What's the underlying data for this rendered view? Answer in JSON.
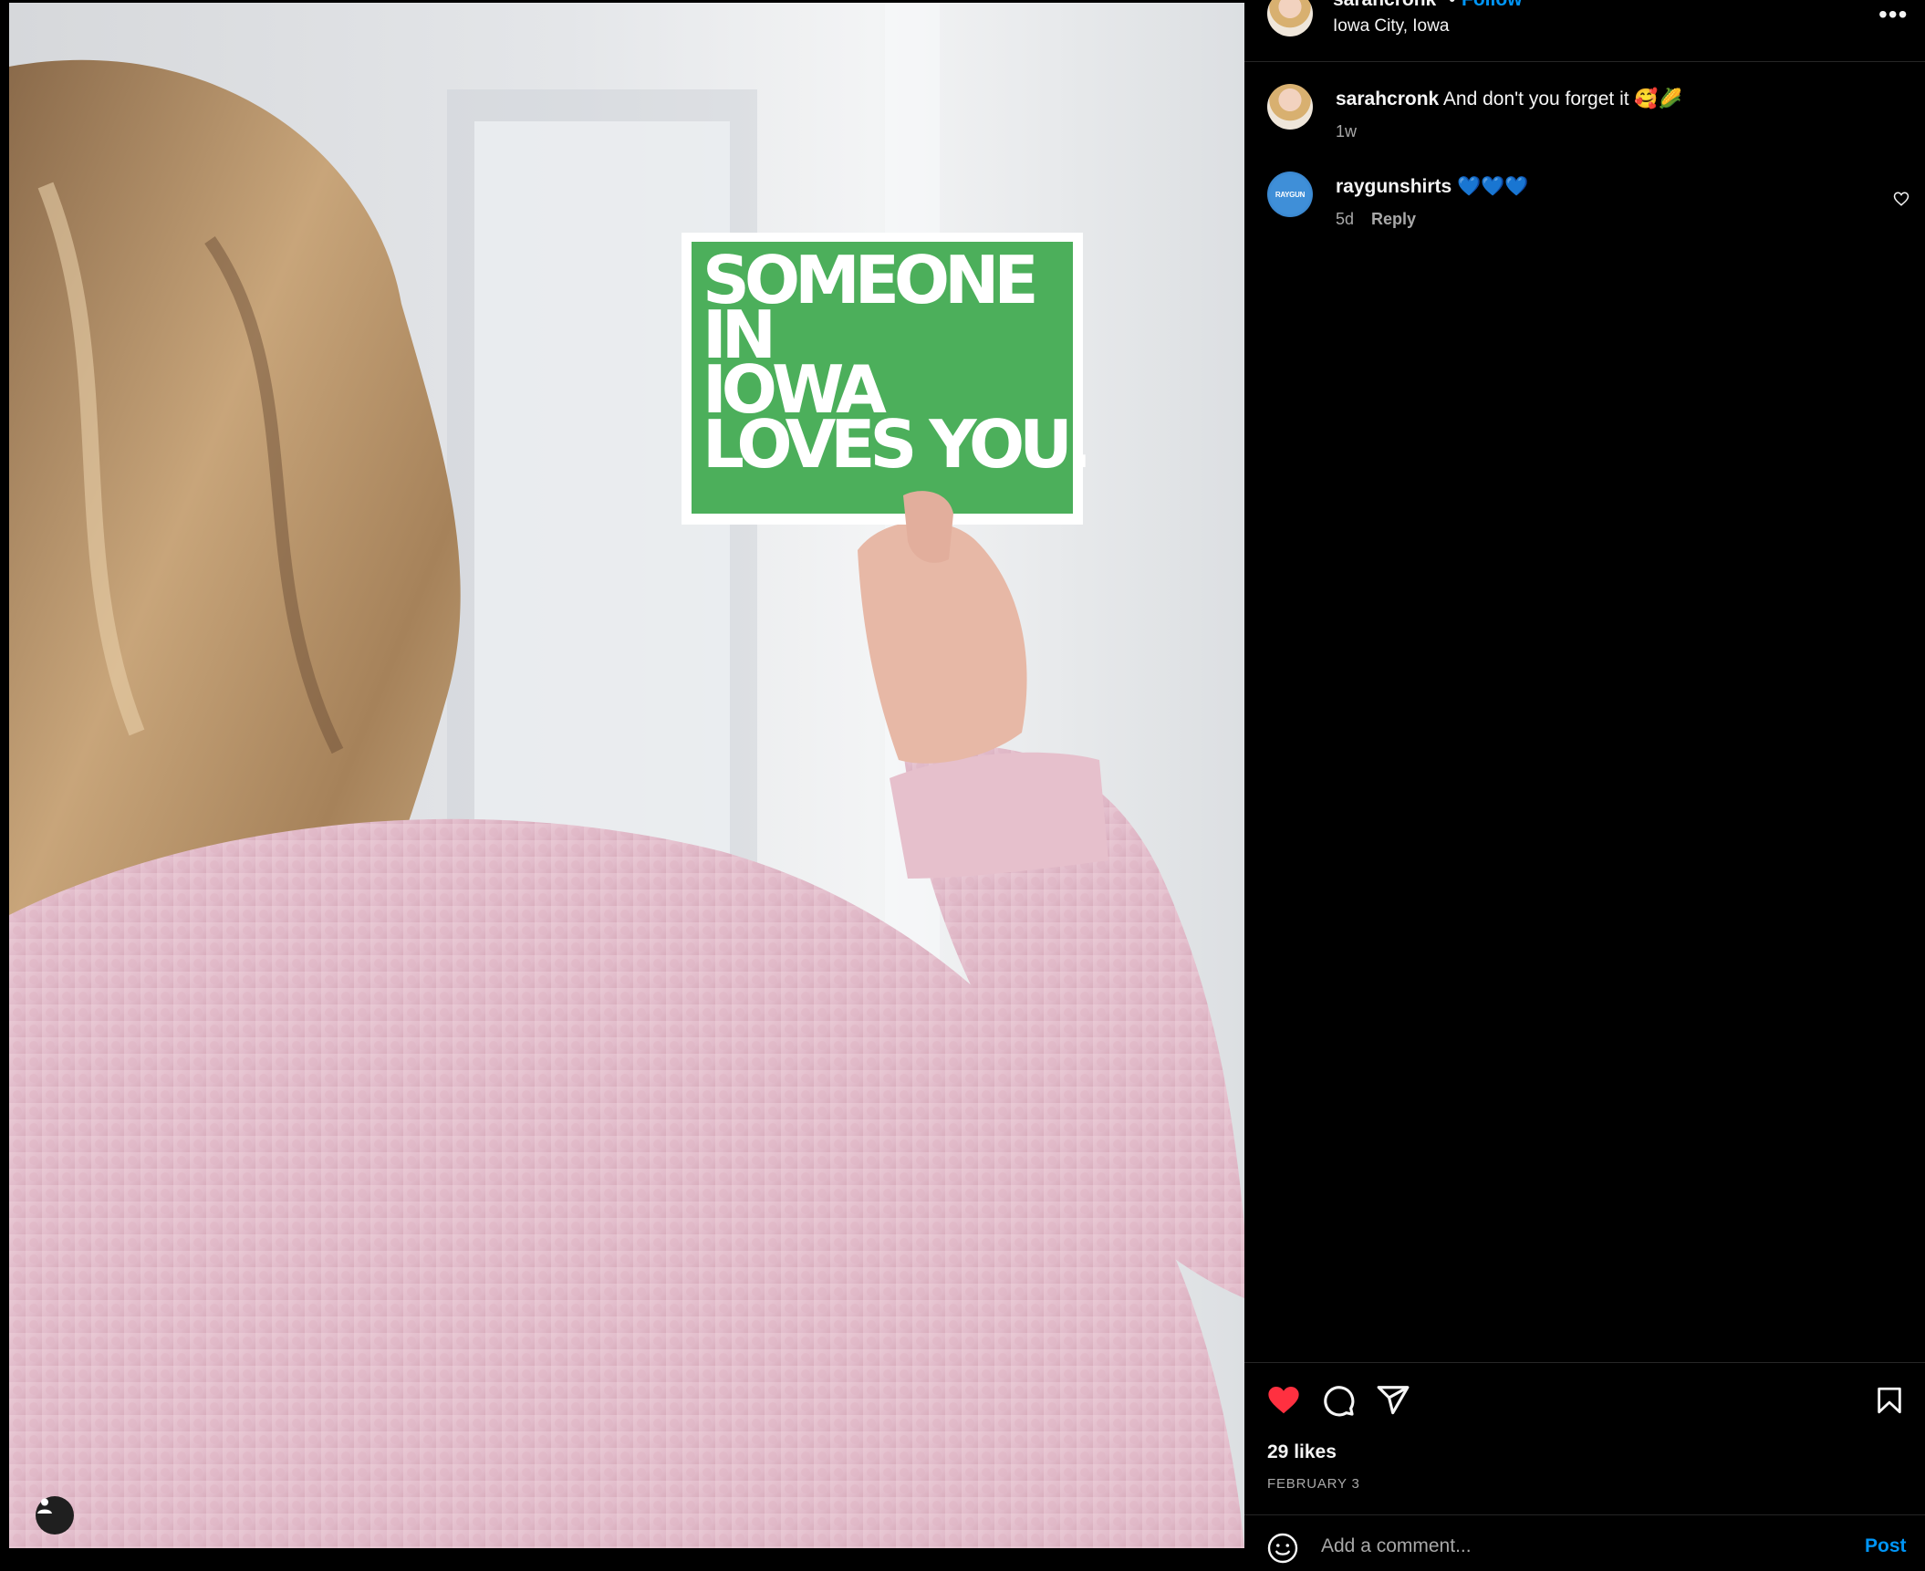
{
  "post": {
    "author": "sarahcronk",
    "separator": "•",
    "follow_label": "Follow",
    "location": "Iowa City, Iowa",
    "more_label": "•••",
    "image": {
      "card_lines": [
        "SOMEONE",
        "IN",
        "IOWA",
        "LOVES YOU."
      ],
      "colors": {
        "card_green": "#4caf5b",
        "sweater": "#e6c3cf",
        "hair": "#b48a5c"
      }
    }
  },
  "comments": [
    {
      "username": "sarahcronk",
      "text": "And don't you forget it 🥰🌽",
      "time": "1w"
    },
    {
      "username": "raygunshirts",
      "text": "💙💙💙",
      "time": "5d",
      "reply_label": "Reply",
      "avatar_text": "RAYGUN"
    }
  ],
  "actions": {
    "like_icon": "heart-filled-icon",
    "comment_icon": "comment-icon",
    "share_icon": "share-icon",
    "save_icon": "bookmark-icon",
    "likes": "29 likes",
    "date": "FEBRUARY 3"
  },
  "composer": {
    "placeholder": "Add a comment...",
    "post_label": "Post",
    "emoji_icon": "emoji-icon"
  },
  "colors": {
    "accent": "#0095f6",
    "like_red": "#ff3040",
    "background": "#000000",
    "muted": "#a8a8a8"
  }
}
